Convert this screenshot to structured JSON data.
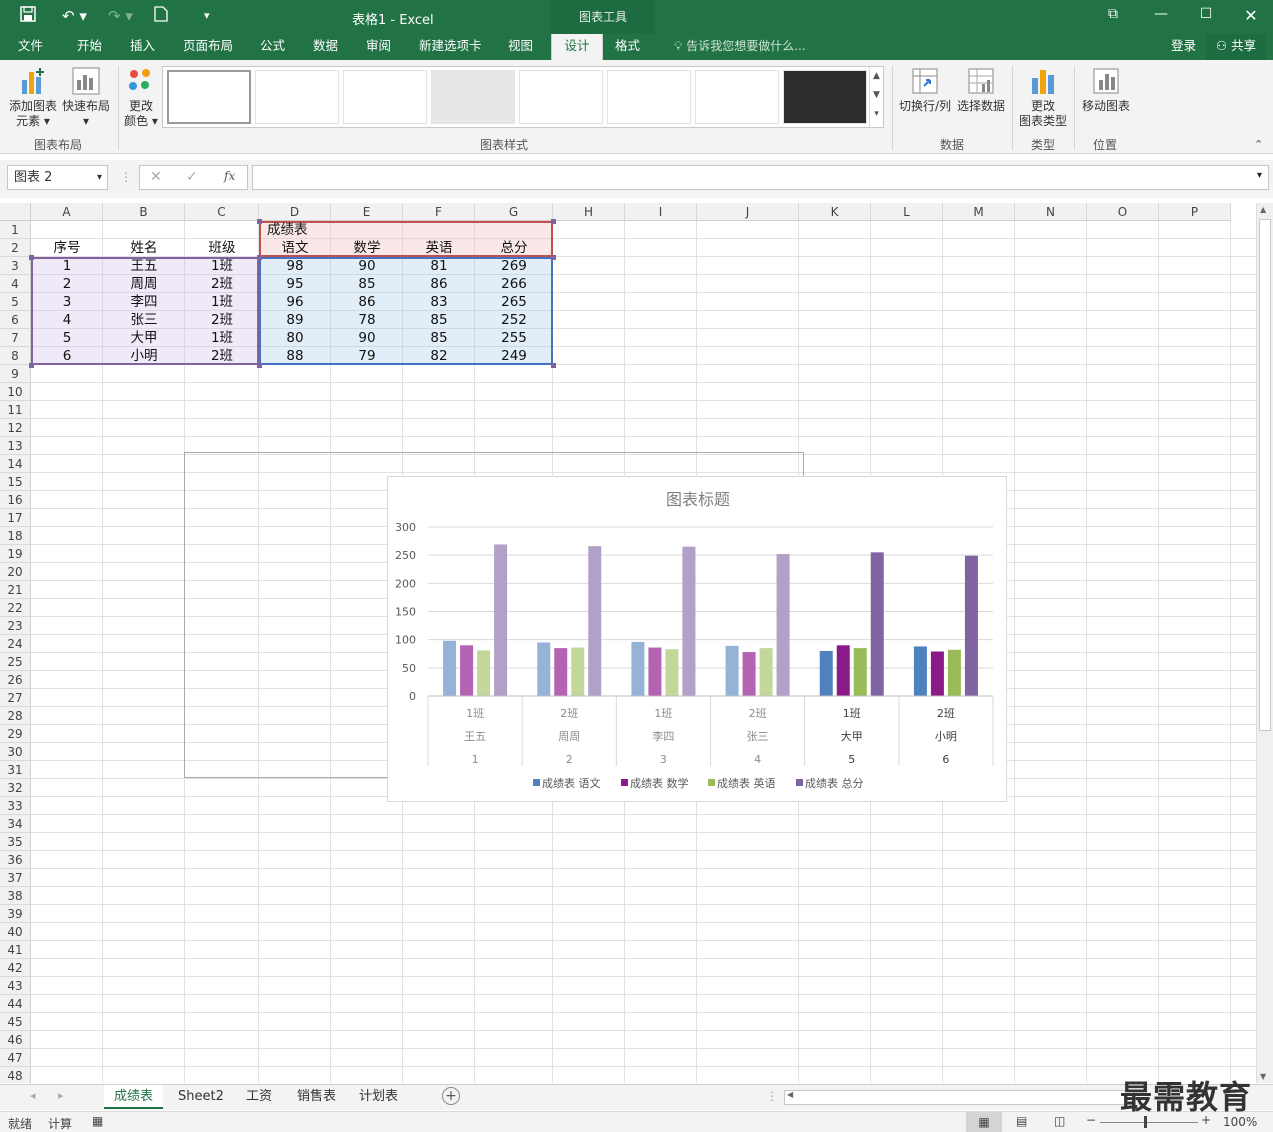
{
  "window": {
    "title": "表格1 - Excel",
    "context_tab_title": "图表工具"
  },
  "ribbon_tabs": [
    "文件",
    "开始",
    "插入",
    "页面布局",
    "公式",
    "数据",
    "审阅",
    "新建选项卡",
    "视图",
    "设计",
    "格式"
  ],
  "active_tab": "设计",
  "tell_me": "告诉我您想要做什么...",
  "account": {
    "login": "登录",
    "share": "共享"
  },
  "ribbon": {
    "add_element": [
      "添加图表",
      "元素"
    ],
    "quick_layout": "快速布局",
    "change_colors": [
      "更改",
      "颜色"
    ],
    "group_layout": "图表布局",
    "group_styles": "图表样式",
    "switch_row_col": "切换行/列",
    "select_data": "选择数据",
    "group_data": "数据",
    "change_type": [
      "更改",
      "图表类型"
    ],
    "group_type": "类型",
    "move_chart": "移动图表",
    "group_location": "位置"
  },
  "formula_bar": {
    "name_box": "图表 2",
    "fx": "fx",
    "formula": ""
  },
  "columns": [
    "A",
    "B",
    "C",
    "D",
    "E",
    "F",
    "G",
    "H",
    "I",
    "J",
    "K",
    "L",
    "M",
    "N",
    "O",
    "P"
  ],
  "rows": [
    "1",
    "2",
    "3",
    "4",
    "5",
    "6",
    "7",
    "8",
    "9",
    "10",
    "11",
    "12",
    "13",
    "14",
    "15",
    "16",
    "17",
    "18",
    "19",
    "20",
    "21",
    "22",
    "23",
    "24",
    "25",
    "26",
    "27",
    "28",
    "29",
    "30",
    "31",
    "32",
    "33",
    "34",
    "35",
    "36",
    "37",
    "38",
    "39",
    "40",
    "41",
    "42",
    "43",
    "44",
    "45",
    "46",
    "47",
    "48"
  ],
  "sheet": {
    "d1": "成绩表",
    "headers": [
      "序号",
      "姓名",
      "班级",
      "语文",
      "数学",
      "英语",
      "总分"
    ],
    "data": [
      [
        "1",
        "王五",
        "1班",
        "98",
        "90",
        "81",
        "269"
      ],
      [
        "2",
        "周周",
        "2班",
        "95",
        "85",
        "86",
        "266"
      ],
      [
        "3",
        "李四",
        "1班",
        "96",
        "86",
        "83",
        "265"
      ],
      [
        "4",
        "张三",
        "2班",
        "89",
        "78",
        "85",
        "252"
      ],
      [
        "5",
        "大甲",
        "1班",
        "80",
        "90",
        "85",
        "255"
      ],
      [
        "6",
        "小明",
        "2班",
        "88",
        "79",
        "82",
        "249"
      ]
    ]
  },
  "chart_data": {
    "type": "bar",
    "title": "图表标题",
    "categories_class": [
      "1班",
      "2班",
      "1班",
      "2班",
      "1班",
      "2班"
    ],
    "categories_name": [
      "王五",
      "周周",
      "李四",
      "张三",
      "大甲",
      "小明"
    ],
    "categories_index": [
      "1",
      "2",
      "3",
      "4",
      "5",
      "6"
    ],
    "yticks": [
      "0",
      "50",
      "100",
      "150",
      "200",
      "250",
      "300"
    ],
    "ylim": [
      0,
      300
    ],
    "grid": true,
    "legend_position": "bottom",
    "series": [
      {
        "name": "成绩表 语文",
        "values": [
          98,
          95,
          96,
          89,
          80,
          88
        ],
        "color": "#4f81bd",
        "faded": "#95b3d7"
      },
      {
        "name": "成绩表 数学",
        "values": [
          90,
          85,
          86,
          78,
          90,
          79
        ],
        "color": "#8b1a89",
        "faded": "#b462b2"
      },
      {
        "name": "成绩表 英语",
        "values": [
          81,
          86,
          83,
          85,
          85,
          82
        ],
        "color": "#9bbb59",
        "faded": "#c4d79b"
      },
      {
        "name": "成绩表 总分",
        "values": [
          269,
          266,
          265,
          252,
          255,
          249
        ],
        "color": "#8064a2",
        "faded": "#b1a0c7"
      }
    ]
  },
  "sheet_tabs": [
    "成绩表",
    "Sheet2",
    "工资",
    "销售表",
    "计划表"
  ],
  "active_sheet": "成绩表",
  "status": {
    "ready": "就绪",
    "calc": "计算",
    "zoom": "100%"
  },
  "watermark": "最需教育"
}
